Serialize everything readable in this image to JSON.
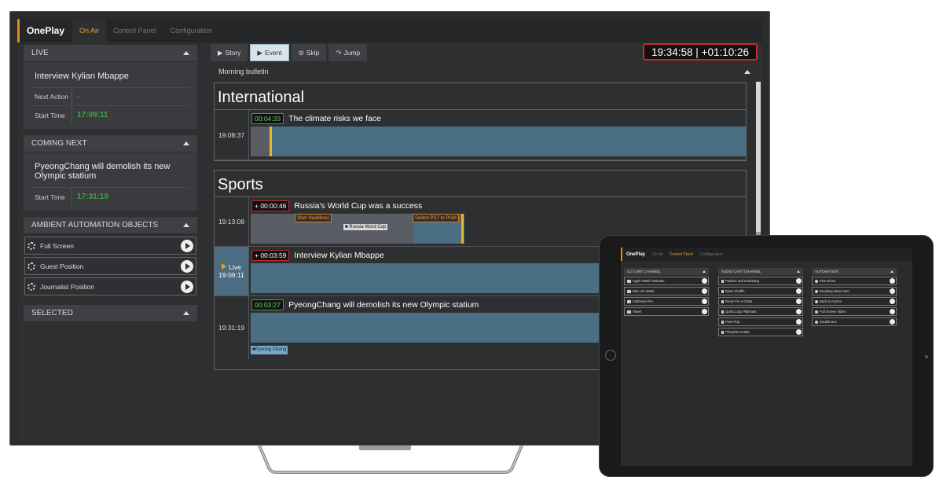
{
  "tv": {
    "nav": {
      "brand": "OnePlay",
      "tabs": [
        "On Air",
        "Control Panel",
        "Configuration"
      ],
      "active_tab": "On Air"
    },
    "live": {
      "title": "LIVE",
      "item": "Interview Kylian Mbappe",
      "next_action_label": "Next Action",
      "next_action_value": "-",
      "start_time_label": "Start Time",
      "start_time_value": "17:09:11"
    },
    "coming_next": {
      "title": "COMING NEXT",
      "item": "PyeongChang will demolish its new Olympic statium",
      "start_time_label": "Start Time",
      "start_time_value": "17:31:19"
    },
    "ambient": {
      "title": "AMBIENT AUTOMATION OBJECTS",
      "items": [
        "Full Screen",
        "Guest Position",
        "Journalist Position"
      ]
    },
    "selected": {
      "title": "SELECTED"
    },
    "toolbar": {
      "story": "Story",
      "event": "Event",
      "skip": "Skip",
      "jump": "Jump"
    },
    "clock": "19:34:58 | +01:10:26",
    "rundown": {
      "title": "Morning bulletin",
      "sections": [
        {
          "name": "International",
          "stories": [
            {
              "time": "19:08:37",
              "duration": "00:04:33",
              "title": "The climate risks we face"
            }
          ]
        },
        {
          "name": "Sports",
          "stories": [
            {
              "time": "19:13:08",
              "duration": "+ 00:00:46",
              "title": "Russia's World Cup was a success",
              "elements": [
                "Start Headlines",
                "Russia Word Cup",
                "Switch PST to PGM"
              ]
            },
            {
              "time": "19:09:11",
              "live_label": "Live",
              "duration": "+ 00:03:59",
              "title": "Interview Kylian Mbappe"
            },
            {
              "time": "19:31:19",
              "duration": "00:03:27",
              "title": "PyeongChang will demolish its new Olympic statium",
              "elements": [
                "Pyeong Chang"
              ]
            }
          ]
        }
      ]
    }
  },
  "tablet": {
    "nav": {
      "brand": "OnePlay",
      "tabs": [
        "On Air",
        "Control Panel",
        "Configuration"
      ],
      "active_tab": "Control Panel"
    },
    "columns": [
      {
        "title": "CG CART CHANNEL",
        "items": [
          "Apple Watch Noteater",
          "Rain On Water",
          "California Fire",
          "Tweet"
        ]
      },
      {
        "title": "AUDIO CART CHANNEL",
        "items": [
          "Positive and motivating",
          "Blues Shuffle",
          "Room For a Ghost",
          "Quick Logo #hitmusic",
          "Funk Pop",
          "Pleoyhas Hedoit"
        ]
      },
      {
        "title": "AUTOMATION",
        "items": [
          "Intro Show",
          "Breaking News Intro",
          "Back to Anchor",
          "Full Screen Video",
          "Double Box"
        ]
      }
    ]
  },
  "colors": {
    "accent": "#f29b2a",
    "live_bar": "#4a6e84",
    "clock_border": "#c42b2b",
    "green_time": "#43a34a"
  }
}
